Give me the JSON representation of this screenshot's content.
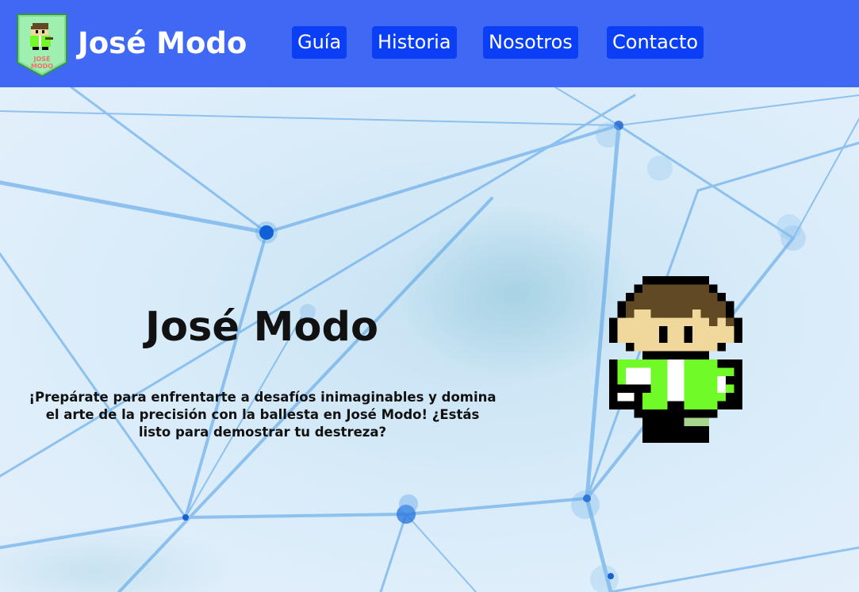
{
  "header": {
    "site_title": "José Modo",
    "logo_text": "JOSÉ MODO",
    "nav": [
      {
        "label": "Guía"
      },
      {
        "label": "Historia"
      },
      {
        "label": "Nosotros"
      },
      {
        "label": "Contacto"
      }
    ]
  },
  "hero": {
    "title": "José Modo",
    "description": "¡Prepárate para enfrentarte a desafíos inimaginables y domina el arte de la precisión con la ballesta en José Modo! ¿Estás listo para demostrar tu destreza?"
  },
  "colors": {
    "header_bg": "#3f69f5",
    "nav_button_bg": "#0a3ff6",
    "hero_bg": "#dcecfb",
    "network_line": "#4f9ee6",
    "sprite_green": "#70fa28",
    "sprite_hair": "#614a23",
    "sprite_skin": "#f0d79b"
  }
}
